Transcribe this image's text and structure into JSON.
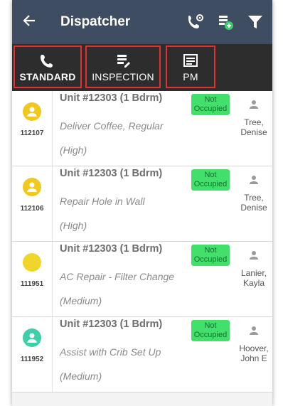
{
  "appbar": {
    "title": "Dispatcher"
  },
  "tabs": [
    {
      "label": "STANDARD",
      "icon": "phone-icon"
    },
    {
      "label": "INSPECTION",
      "icon": "inspection-icon"
    },
    {
      "label": "PM",
      "icon": "pm-icon"
    }
  ],
  "work_orders": [
    {
      "id": "112107",
      "unit": "Unit #12303 (1 Bdrm)",
      "description": "Deliver Coffee, Regular",
      "priority": "(High)",
      "occupancy": "Not Occupied",
      "technician": [
        "Tree,",
        "Denise"
      ],
      "status_color": "#f0c81e"
    },
    {
      "id": "112106",
      "unit": "Unit #12303 (1 Bdrm)",
      "description": "Repair Hole in Wall",
      "priority": "(High)",
      "occupancy": "Not Occupied",
      "technician": [
        "Tree,",
        "Denise"
      ],
      "status_color": "#f0c81e"
    },
    {
      "id": "111951",
      "unit": "Unit #12303 (1 Bdrm)",
      "description": "AC Repair - Filter Change",
      "priority": "(Medium)",
      "occupancy": "Not Occupied",
      "technician": [
        "Lanier,",
        "Kayla"
      ],
      "status_color": "#f0d62a"
    },
    {
      "id": "111952",
      "unit": "Unit #12303 (1 Bdrm)",
      "description": "Assist with Crib Set Up",
      "priority": "(Medium)",
      "occupancy": "Not Occupied",
      "technician": [
        "Hoover,",
        "John E"
      ],
      "status_color": "#3ccfa8"
    }
  ],
  "colors": {
    "appbar": "#3f4d63",
    "tabbar": "#2d2d2d",
    "badge": "#42e06b",
    "highlight": "#e53030"
  }
}
